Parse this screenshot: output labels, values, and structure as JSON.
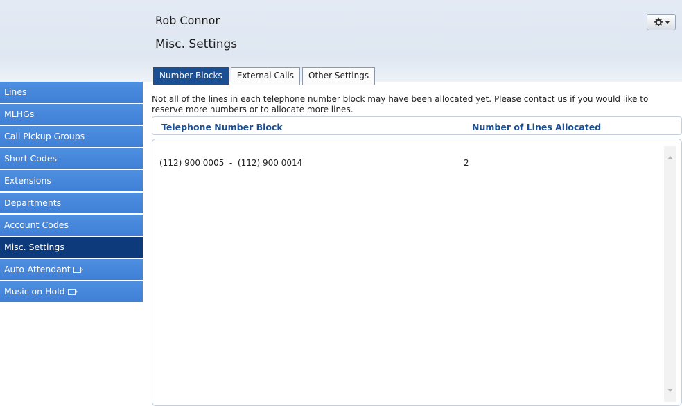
{
  "header": {
    "user_name": "Rob Connor",
    "page_title": "Misc. Settings",
    "settings_icon": "gear-icon"
  },
  "tabs": [
    {
      "label": "Number Blocks",
      "active": true
    },
    {
      "label": "External Calls",
      "active": false
    },
    {
      "label": "Other Settings",
      "active": false
    }
  ],
  "info_text": "Not all of the lines in each telephone number block may have been allocated yet. Please contact us if you would like to reserve more numbers or to allocate more lines.",
  "table": {
    "columns": [
      "Telephone Number Block",
      "Number of Lines Allocated"
    ],
    "rows": [
      {
        "block": "(112) 900 0005  -  (112) 900 0014",
        "lines": "2"
      }
    ]
  },
  "sidebar": {
    "items": [
      {
        "label": "Lines",
        "active": false,
        "external": false
      },
      {
        "label": "MLHGs",
        "active": false,
        "external": false
      },
      {
        "label": "Call Pickup Groups",
        "active": false,
        "external": false
      },
      {
        "label": "Short Codes",
        "active": false,
        "external": false
      },
      {
        "label": "Extensions",
        "active": false,
        "external": false
      },
      {
        "label": "Departments",
        "active": false,
        "external": false
      },
      {
        "label": "Account Codes",
        "active": false,
        "external": false
      },
      {
        "label": "Misc. Settings",
        "active": true,
        "external": false
      },
      {
        "label": "Auto-Attendant",
        "active": false,
        "external": true
      },
      {
        "label": "Music on Hold",
        "active": false,
        "external": true
      }
    ]
  },
  "colors": {
    "nav_bg": "#3f7fd6",
    "nav_active": "#0d3a7a",
    "tab_active": "#1b4f93",
    "header_text": "#1b4f93"
  }
}
